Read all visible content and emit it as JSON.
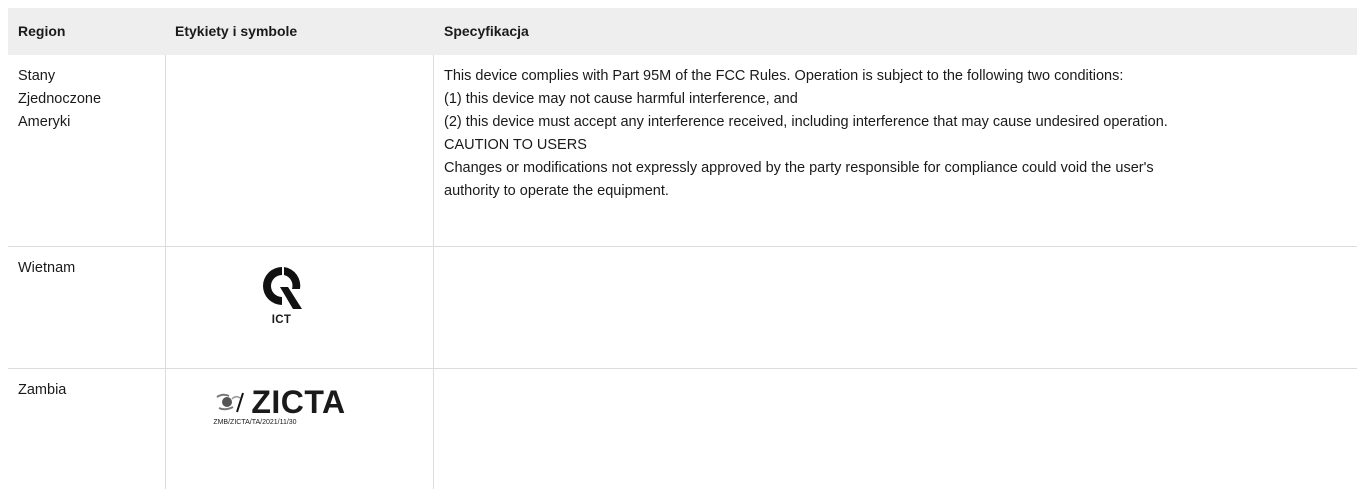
{
  "table": {
    "headers": [
      "Region",
      "Etykiety i symbole",
      "Specyfikacja"
    ],
    "rows": [
      {
        "region": "Stany Zjednoczone Ameryki",
        "spec_lines": [
          "This device complies with Part 95M of the FCC Rules. Operation is subject to the following two conditions:",
          "(1) this device may not cause harmful interference, and",
          "(2) this device must accept any interference received, including interference that may cause undesired operation.",
          "CAUTION TO USERS",
          "Changes or modifications not expressly approved by the party responsible for compliance could void the user's",
          "authority to operate the equipment."
        ]
      },
      {
        "region": "Wietnam",
        "logo": {
          "name": "ict-logo",
          "text": "ICT"
        }
      },
      {
        "region": "Zambia",
        "logo": {
          "name": "zicta-logo",
          "text": "ZICTA",
          "ref": "ZMB/ZICTA/TA/2021/11/30"
        }
      }
    ]
  }
}
